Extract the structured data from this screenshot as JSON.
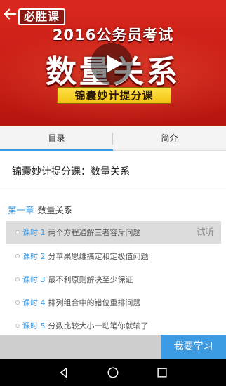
{
  "banner": {
    "logo": "必胜课",
    "headline": "2016公务员考试",
    "big_title": "数量关系",
    "subtitle": "锦囊妙计提分课"
  },
  "tabs": [
    {
      "label": "目录",
      "active": true
    },
    {
      "label": "简介",
      "active": false
    }
  ],
  "course": {
    "title": "锦囊妙计提分课：数量关系"
  },
  "chapter": {
    "number": "第一章",
    "name": "数量关系"
  },
  "lessons": [
    {
      "label": "课时 1",
      "text": "两个方程通解三者容斥问题",
      "trial": "试听"
    },
    {
      "label": "课时 2",
      "text": "分苹果思维搞定和定极值问题",
      "trial": ""
    },
    {
      "label": "课时 3",
      "text": "最不利原则解决至少保证",
      "trial": ""
    },
    {
      "label": "课时 4",
      "text": "排列组合中的错位重排问题",
      "trial": ""
    },
    {
      "label": "课时 5",
      "text": "分数比较大小一动笔你就输了",
      "trial": ""
    }
  ],
  "action": {
    "study_label": "我要学习"
  },
  "colors": {
    "accent": "#3d9be3",
    "banner_red": "#c81c14",
    "subtitle_yellow": "#f2c40f"
  },
  "icons": {
    "back": "back-arrow-icon",
    "play": "play-icon",
    "nav_back": "nav-back-icon",
    "nav_home": "nav-home-icon",
    "nav_recents": "nav-recents-icon"
  }
}
